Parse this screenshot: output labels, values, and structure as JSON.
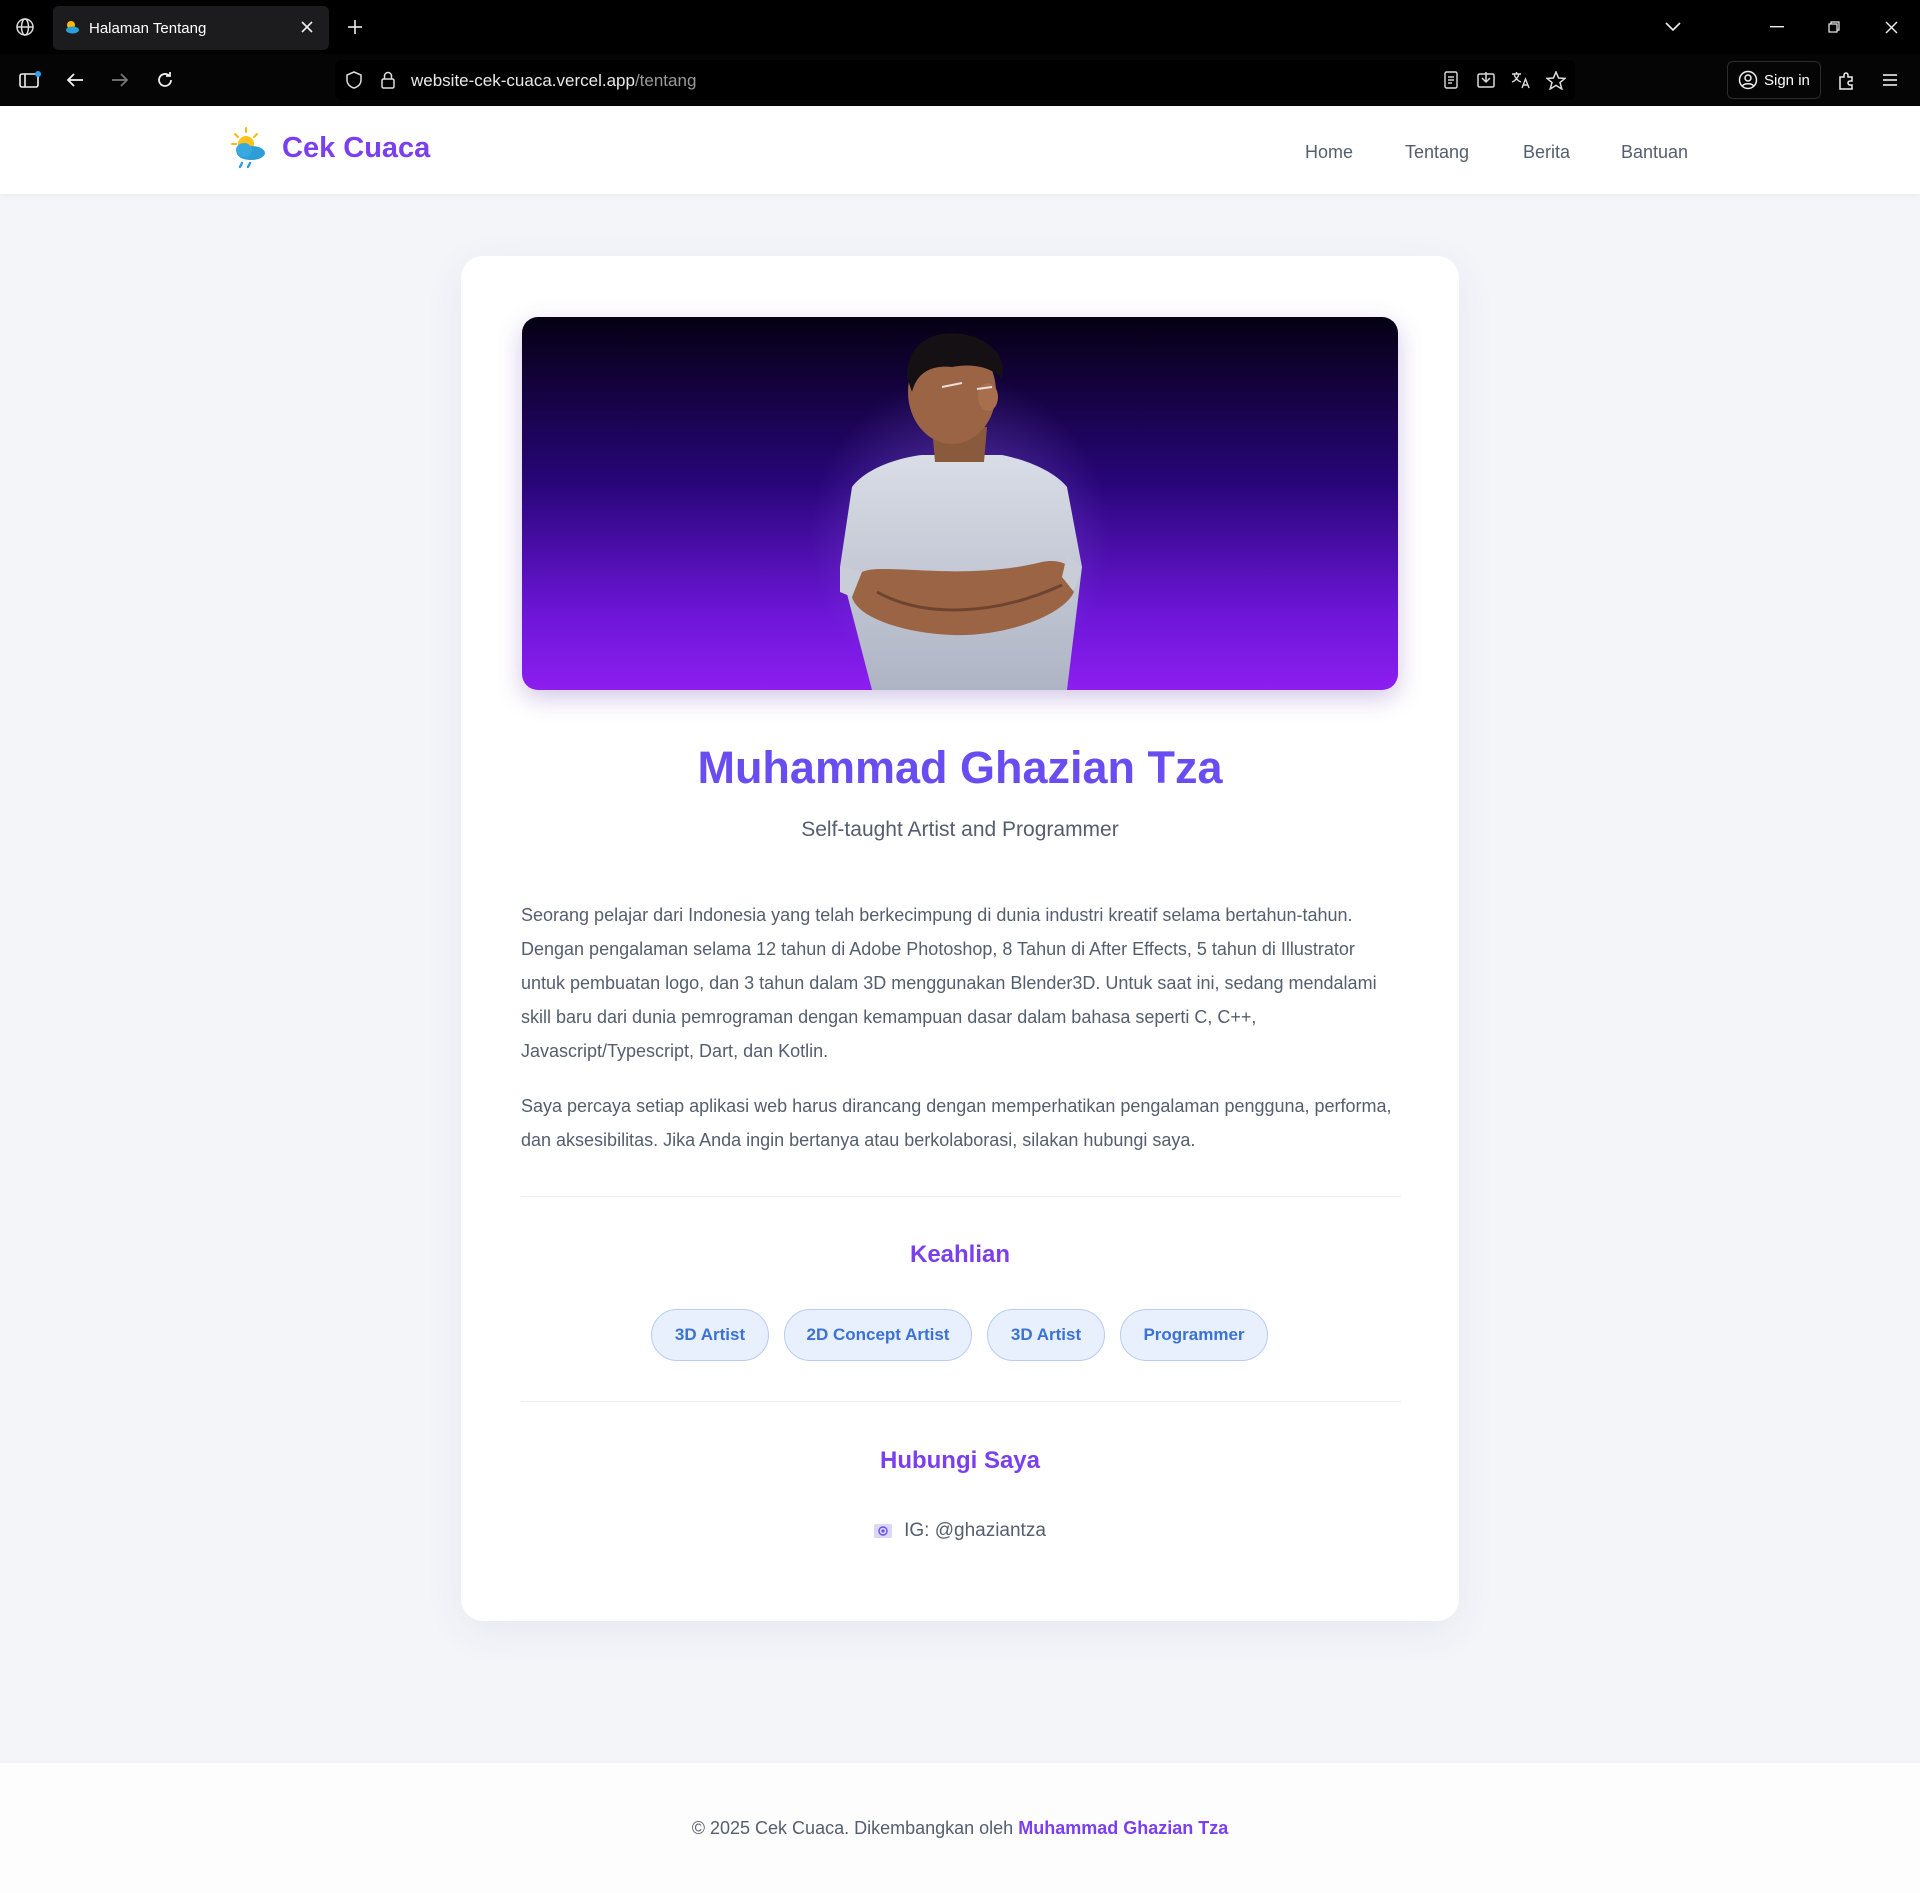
{
  "browser": {
    "tab_title": "Halaman Tentang",
    "url_domain": "website-cek-cuaca.vercel.app",
    "url_path": "/tentang",
    "signin_label": "Sign in"
  },
  "site": {
    "logo_text": "Cek Cuaca",
    "nav": [
      "Home",
      "Tentang",
      "Berita",
      "Bantuan"
    ]
  },
  "profile": {
    "name": "Muhammad Ghazian Tza",
    "subtitle": "Self-taught Artist and Programmer",
    "bio_1": "Seorang pelajar dari Indonesia yang telah berkecimpung di dunia industri kreatif selama bertahun-tahun. Dengan pengalaman selama 12 tahun di Adobe Photoshop, 8 Tahun di After Effects, 5 tahun di Illustrator untuk pembuatan logo, dan 3 tahun dalam 3D menggunakan Blender3D. Untuk saat ini, sedang mendalami skill baru dari dunia pemrograman dengan kemampuan dasar dalam bahasa seperti C, C++, Javascript/Typescript, Dart, dan Kotlin.",
    "bio_2": "Saya percaya setiap aplikasi web harus dirancang dengan memperhatikan pengalaman pengguna, performa, dan aksesibilitas. Jika Anda ingin bertanya atau berkolaborasi, silakan hubungi saya.",
    "skills_title": "Keahlian",
    "skills": [
      "3D Artist",
      "2D Concept Artist",
      "3D Artist",
      "Programmer"
    ],
    "contact_title": "Hubungi Saya",
    "contact_ig": "IG: @ghaziantza"
  },
  "footer": {
    "text": "© 2025 Cek Cuaca. Dikembangkan oleh",
    "author": "Muhammad Ghazian Tza"
  },
  "colors": {
    "accent": "#7b3ff0",
    "chip_text": "#3a73d3",
    "hero_gradient_bottom": "#8d1ef0"
  }
}
